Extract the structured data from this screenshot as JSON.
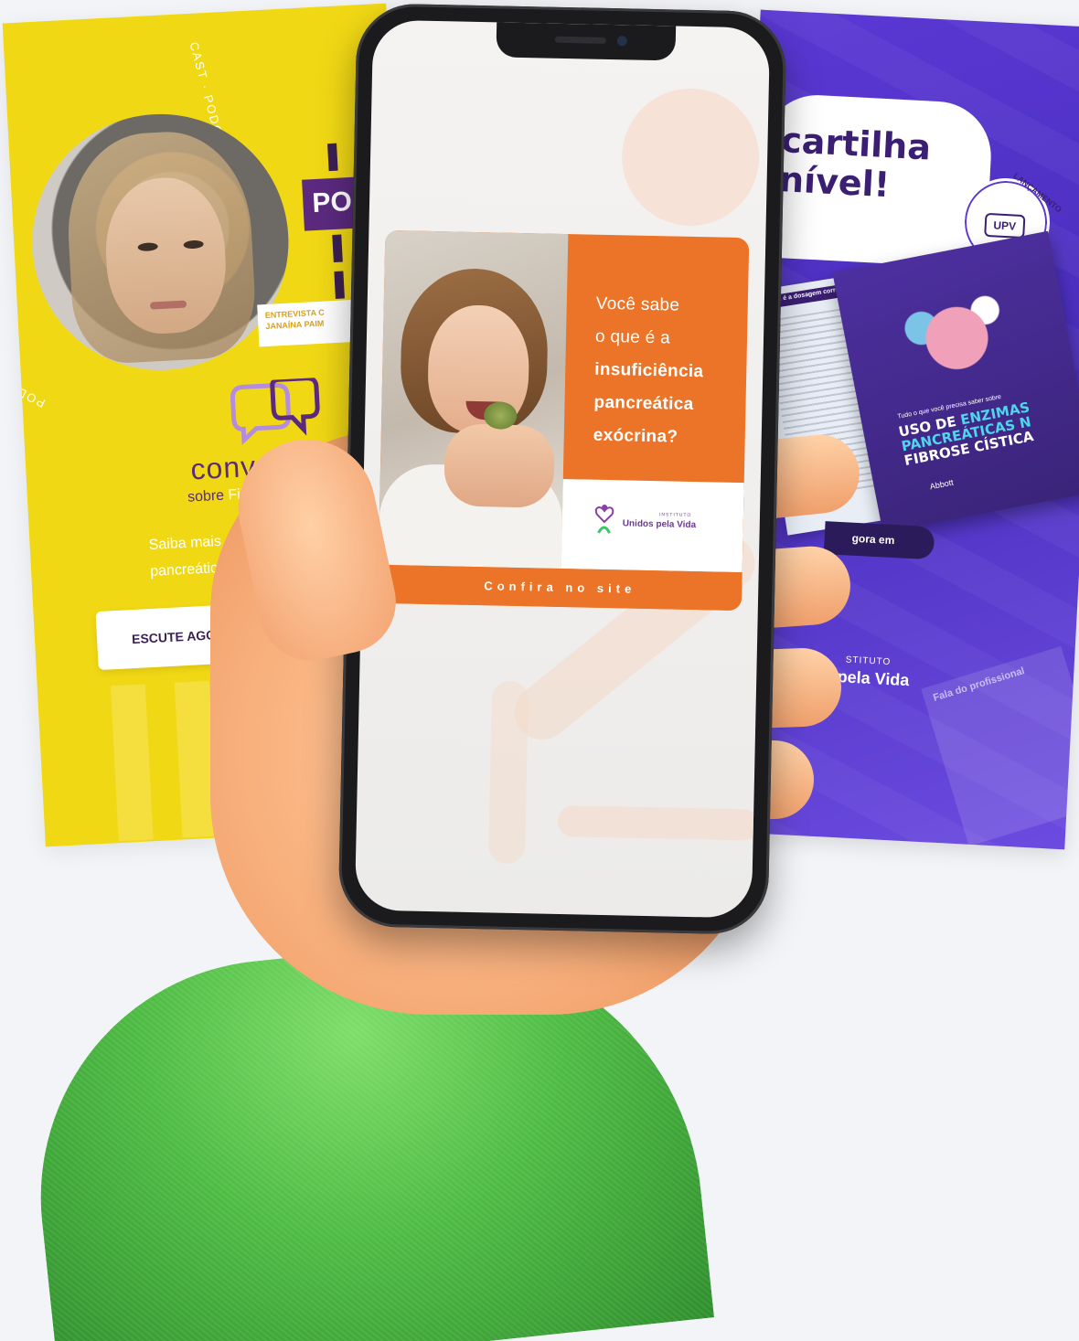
{
  "podcast_card": {
    "ring_text_top": "CAST · PODCAST",
    "ring_text_bottom": "PODCAST ·",
    "tag_text": "PO",
    "interview_line1": "ENTREVISTA C",
    "interview_line2": "JANAÍNA PAIM",
    "title": "convers",
    "subtitle_prefix": "sobre ",
    "subtitle_highlight": "Fibr",
    "info_line1": "Saiba mais sobre",
    "info_line2": "pancreática",
    "cta_label": "ESCUTE AGORA EM"
  },
  "booklet_card": {
    "headline_line1": "cartilha",
    "headline_line2": "nível!",
    "badge_text": "LANÇAMENTO",
    "badge_logo": "UPV",
    "back_page_header": "Qual é a dosagem correta?",
    "front_small": "Tudo o que você precisa saber sobre",
    "front_title_line1_a": "USO DE ",
    "front_title_line1_b": "ENZIMAS",
    "front_title_line2": "PANCREÁTICAS N",
    "front_title_line3": "FIBROSE CÍSTICA",
    "sponsor": "Abbott",
    "cta_label": "gora em",
    "org_small": "STITUTO",
    "org_name": "pela Vida",
    "doc_title": "Fala do profissional"
  },
  "phone_ad": {
    "question_line1": "Você sabe",
    "question_line2": "o que é a",
    "question_bold1": "insuficiência",
    "question_bold2": "pancreática",
    "question_bold3": "exócrina?",
    "logo_small": "INSTITUTO",
    "logo_name": "Unidos pela Vida",
    "cta_label": "Confira no site"
  },
  "colors": {
    "yellow": "#f1d815",
    "purple_card": "#5a38d4",
    "ad_orange": "#ec7428",
    "sleeve_green": "#4fbc44"
  }
}
